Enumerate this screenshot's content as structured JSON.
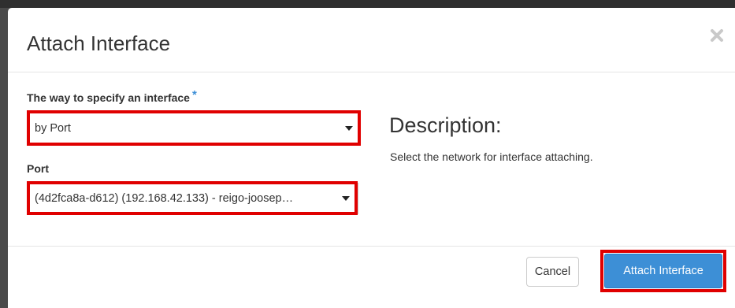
{
  "modal": {
    "title": "Attach Interface"
  },
  "form": {
    "interface_way": {
      "label": "The way to specify an interface",
      "required_marker": "*",
      "selected": "by Port"
    },
    "port": {
      "label": "Port",
      "selected": "(4d2fca8a-d612) (192.168.42.133) - reigo-joosep…"
    }
  },
  "description": {
    "title": "Description:",
    "text": "Select the network for interface attaching."
  },
  "footer": {
    "cancel_label": "Cancel",
    "submit_label": "Attach Interface"
  },
  "icons": {
    "close": "close-icon",
    "dropdown": "caret-down-icon"
  },
  "colors": {
    "primary": "#3d8fd6",
    "highlight": "#e00000",
    "required": "#3b8ed6"
  }
}
